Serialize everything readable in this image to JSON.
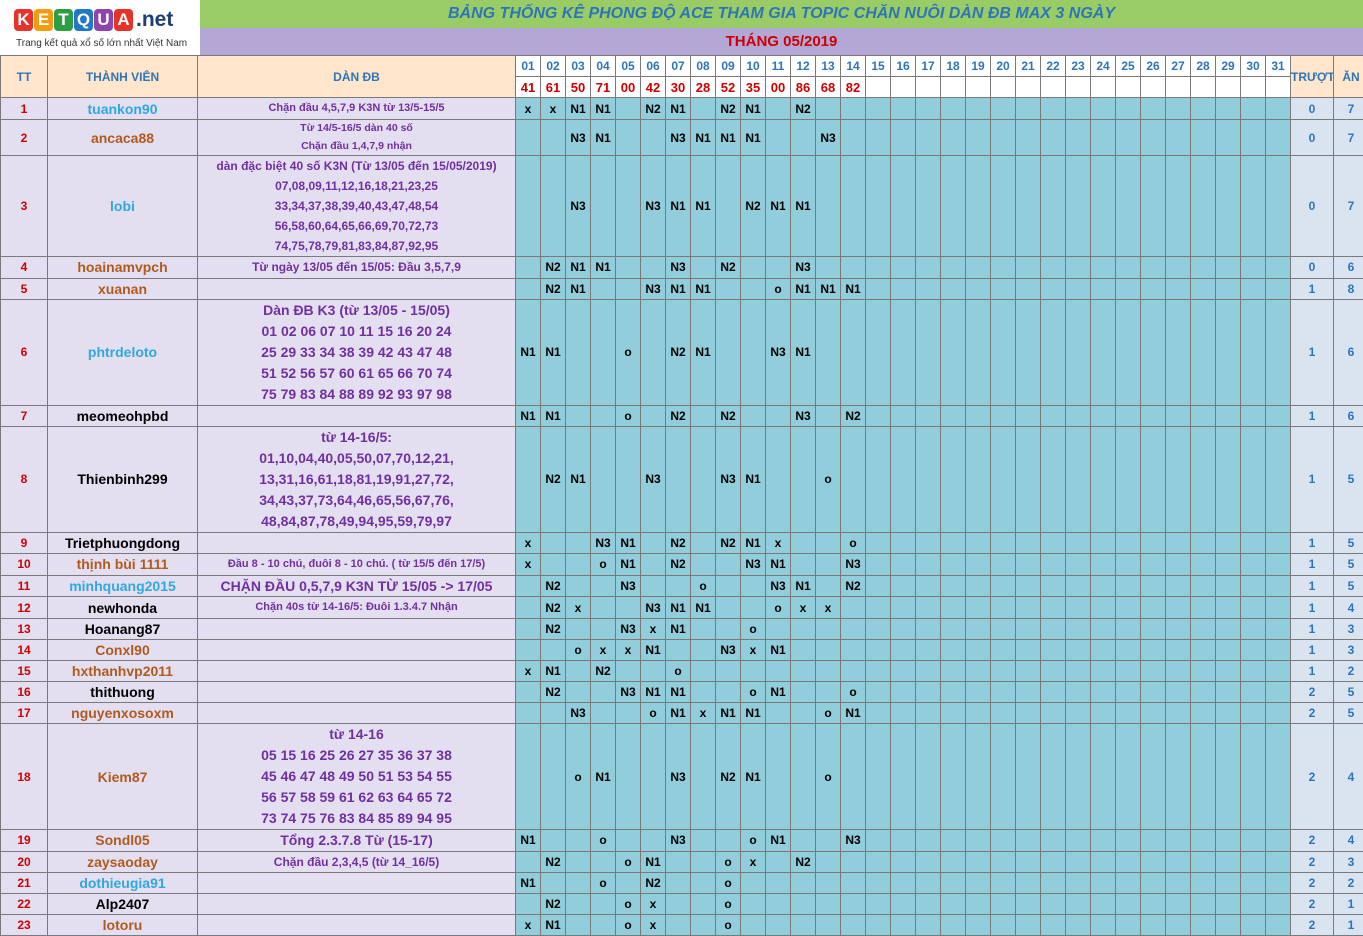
{
  "logo": {
    "letters": [
      "K",
      "E",
      "T",
      "Q",
      "U",
      "A"
    ],
    "suffix": ".net",
    "tagline": "Trang kết quả xổ số lớn nhất Việt Nam",
    "colors": [
      "#e6332a",
      "#f39c12",
      "#2e9e44",
      "#1f78c8",
      "#8e44ad",
      "#e6332a"
    ]
  },
  "title": "BẢNG THỐNG KÊ PHONG ĐỘ ACE THAM GIA TOPIC CHĂN NUÔI DÀN ĐB MAX 3 NGÀY",
  "month": "THÁNG 05/2019",
  "headers": {
    "tt": "TT",
    "member": "THÀNH VIÊN",
    "dan": "DÀN ĐB",
    "truot": "TRƯỢT",
    "an": "ĂN"
  },
  "days": [
    "01",
    "02",
    "03",
    "04",
    "05",
    "06",
    "07",
    "08",
    "09",
    "10",
    "11",
    "12",
    "13",
    "14",
    "15",
    "16",
    "17",
    "18",
    "19",
    "20",
    "21",
    "22",
    "23",
    "24",
    "25",
    "26",
    "27",
    "28",
    "29",
    "30",
    "31"
  ],
  "results": [
    "41",
    "61",
    "50",
    "71",
    "00",
    "42",
    "30",
    "28",
    "52",
    "35",
    "00",
    "86",
    "68",
    "82",
    "",
    "",
    "",
    "",
    "",
    "",
    "",
    "",
    "",
    "",
    "",
    "",
    "",
    "",
    "",
    "",
    ""
  ],
  "rows": [
    {
      "tt": "1",
      "name": "tuankon90",
      "color": "#2ea8e0",
      "dan": [
        "Chặn đầu 4,5,7,9 K3N từ 13/5-15/5"
      ],
      "fs": 11,
      "h": 21,
      "c": [
        "x",
        "x",
        "N1",
        "N1",
        "",
        "N2",
        "N1",
        "",
        "N2",
        "N1",
        "",
        "N2",
        "",
        "",
        "",
        "",
        "",
        "",
        "",
        "",
        "",
        "",
        "",
        "",
        "",
        "",
        "",
        "",
        "",
        "",
        ""
      ],
      "truot": "0",
      "an": "7"
    },
    {
      "tt": "2",
      "name": "ancaca88",
      "color": "#b05a1e",
      "dan": [
        "Từ 14/5-16/5 dàn 40 số",
        "Chặn đầu 1,4,7,9 nhận"
      ],
      "fs": 10.5,
      "h": 35,
      "c": [
        "",
        "",
        "N3",
        "N1",
        "",
        "",
        "N3",
        "N1",
        "N1",
        "N1",
        "",
        "",
        "N3",
        "",
        "",
        "",
        "",
        "",
        "",
        "",
        "",
        "",
        "",
        "",
        "",
        "",
        "",
        "",
        "",
        "",
        ""
      ],
      "truot": "0",
      "an": "7"
    },
    {
      "tt": "3",
      "name": "lobi",
      "color": "#2ea8e0",
      "dan": [
        "dàn đặc biệt 40 số K3N (Từ 13/05 đến 15/05/2019)",
        "07,08,09,11,12,16,18,21,23,25",
        "33,34,37,38,39,40,43,47,48,54",
        "56,58,60,64,65,66,69,70,72,73",
        "74,75,78,79,81,83,84,87,92,95"
      ],
      "fs": 12,
      "h": 100,
      "c": [
        "",
        "",
        "N3",
        "",
        "",
        "N3",
        "N1",
        "N1",
        "",
        "N2",
        "N1",
        "N1",
        "",
        "",
        "",
        "",
        "",
        "",
        "",
        "",
        "",
        "",
        "",
        "",
        "",
        "",
        "",
        "",
        "",
        "",
        ""
      ],
      "truot": "0",
      "an": "7"
    },
    {
      "tt": "4",
      "name": "hoainamvpch",
      "color": "#b05a1e",
      "dan": [
        "Từ ngày 13/05 đến 15/05: Đầu 3,5,7,9"
      ],
      "fs": 12,
      "h": 21,
      "c": [
        "",
        "N2",
        "N1",
        "N1",
        "",
        "",
        "N3",
        "",
        "N2",
        "",
        "",
        "N3",
        "",
        "",
        "",
        "",
        "",
        "",
        "",
        "",
        "",
        "",
        "",
        "",
        "",
        "",
        "",
        "",
        "",
        "",
        ""
      ],
      "truot": "0",
      "an": "6"
    },
    {
      "tt": "5",
      "name": "xuanan",
      "color": "#b05a1e",
      "dan": [
        ""
      ],
      "fs": 12,
      "h": 21,
      "c": [
        "",
        "N2",
        "N1",
        "",
        "",
        "N3",
        "N1",
        "N1",
        "",
        "",
        "o",
        "N1",
        "N1",
        "N1",
        "",
        "",
        "",
        "",
        "",
        "",
        "",
        "",
        "",
        "",
        "",
        "",
        "",
        "",
        "",
        "",
        ""
      ],
      "truot": "1",
      "an": "8"
    },
    {
      "tt": "6",
      "name": "phtrdeloto",
      "color": "#2ea8e0",
      "dan": [
        "Dàn ĐB K3 (từ 13/05 - 15/05)",
        "01 02 06 07 10 11 15 16 20 24",
        "25 29 33 34 38 39 42 43 47 48",
        "51 52 56 57 60 61 65 66 70 74",
        "75 79 83 84 88 89 92 93 97 98"
      ],
      "fs": 14,
      "h": 105,
      "c": [
        "N1",
        "N1",
        "",
        "",
        "o",
        "",
        "N2",
        "N1",
        "",
        "",
        "N3",
        "N1",
        "",
        "",
        "",
        "",
        "",
        "",
        "",
        "",
        "",
        "",
        "",
        "",
        "",
        "",
        "",
        "",
        "",
        "",
        ""
      ],
      "truot": "1",
      "an": "6"
    },
    {
      "tt": "7",
      "name": "meomeohpbd",
      "color": "#000000",
      "dan": [
        ""
      ],
      "fs": 12,
      "h": 21,
      "c": [
        "N1",
        "N1",
        "",
        "",
        "o",
        "",
        "N2",
        "",
        "N2",
        "",
        "",
        "N3",
        "",
        "N2",
        "",
        "",
        "",
        "",
        "",
        "",
        "",
        "",
        "",
        "",
        "",
        "",
        "",
        "",
        "",
        "",
        ""
      ],
      "truot": "1",
      "an": "6"
    },
    {
      "tt": "8",
      "name": "Thienbinh299",
      "color": "#000000",
      "dan": [
        "từ 14-16/5:",
        "01,10,04,40,05,50,07,70,12,21,",
        "13,31,16,61,18,81,19,91,27,72,",
        "34,43,37,73,64,46,65,56,67,76,",
        "48,84,87,78,49,94,95,59,79,97"
      ],
      "fs": 14,
      "h": 105,
      "c": [
        "",
        "N2",
        "N1",
        "",
        "",
        "N3",
        "",
        "",
        "N3",
        "N1",
        "",
        "",
        "o",
        "",
        "",
        "",
        "",
        "",
        "",
        "",
        "",
        "",
        "",
        "",
        "",
        "",
        "",
        "",
        "",
        "",
        ""
      ],
      "truot": "1",
      "an": "5"
    },
    {
      "tt": "9",
      "name": "Trietphuongdong",
      "color": "#000000",
      "dan": [
        ""
      ],
      "fs": 12,
      "h": 21,
      "c": [
        "x",
        "",
        "",
        "N3",
        "N1",
        "",
        "N2",
        "",
        "N2",
        "N1",
        "x",
        "",
        "",
        "o",
        "",
        "",
        "",
        "",
        "",
        "",
        "",
        "",
        "",
        "",
        "",
        "",
        "",
        "",
        "",
        "",
        ""
      ],
      "truot": "1",
      "an": "5"
    },
    {
      "tt": "10",
      "name": "thịnh bùi 1111",
      "color": "#b05a1e",
      "dan": [
        "Đầu 8 - 10 chú, đuôi 8 - 10 chú. ( từ 15/5 đến 17/5)"
      ],
      "fs": 11,
      "h": 21,
      "c": [
        "x",
        "",
        "",
        "o",
        "N1",
        "",
        "N2",
        "",
        "",
        "N3",
        "N1",
        "",
        "",
        "N3",
        "",
        "",
        "",
        "",
        "",
        "",
        "",
        "",
        "",
        "",
        "",
        "",
        "",
        "",
        "",
        "",
        ""
      ],
      "truot": "1",
      "an": "5"
    },
    {
      "tt": "11",
      "name": "minhquang2015",
      "color": "#2ea8e0",
      "dan": [
        "CHẶN ĐẦU 0,5,7,9 K3N TỪ 15/05 -> 17/05"
      ],
      "fs": 14,
      "h": 21,
      "c": [
        "",
        "N2",
        "",
        "",
        "N3",
        "",
        "",
        "o",
        "",
        "",
        "N3",
        "N1",
        "",
        "N2",
        "",
        "",
        "",
        "",
        "",
        "",
        "",
        "",
        "",
        "",
        "",
        "",
        "",
        "",
        "",
        "",
        ""
      ],
      "truot": "1",
      "an": "5"
    },
    {
      "tt": "12",
      "name": "newhonda",
      "color": "#000000",
      "dan": [
        "Chặn 40s từ 14-16/5: Đuôi 1.3.4.7 Nhận"
      ],
      "fs": 11,
      "h": 21,
      "c": [
        "",
        "N2",
        "x",
        "",
        "",
        "N3",
        "N1",
        "N1",
        "",
        "",
        "o",
        "x",
        "x",
        "",
        "",
        "",
        "",
        "",
        "",
        "",
        "",
        "",
        "",
        "",
        "",
        "",
        "",
        "",
        "",
        "",
        ""
      ],
      "truot": "1",
      "an": "4"
    },
    {
      "tt": "13",
      "name": "Hoanang87",
      "color": "#000000",
      "dan": [
        ""
      ],
      "fs": 12,
      "h": 21,
      "c": [
        "",
        "N2",
        "",
        "",
        "N3",
        "x",
        "N1",
        "",
        "",
        "o",
        "",
        "",
        "",
        "",
        "",
        "",
        "",
        "",
        "",
        "",
        "",
        "",
        "",
        "",
        "",
        "",
        "",
        "",
        "",
        "",
        ""
      ],
      "truot": "1",
      "an": "3"
    },
    {
      "tt": "14",
      "name": "Conxl90",
      "color": "#b05a1e",
      "dan": [
        ""
      ],
      "fs": 12,
      "h": 21,
      "c": [
        "",
        "",
        "o",
        "x",
        "x",
        "N1",
        "",
        "",
        "N3",
        "x",
        "N1",
        "",
        "",
        "",
        "",
        "",
        "",
        "",
        "",
        "",
        "",
        "",
        "",
        "",
        "",
        "",
        "",
        "",
        "",
        "",
        ""
      ],
      "truot": "1",
      "an": "3"
    },
    {
      "tt": "15",
      "name": "hxthanhvp2011",
      "color": "#b05a1e",
      "dan": [
        ""
      ],
      "fs": 12,
      "h": 21,
      "c": [
        "x",
        "N1",
        "",
        "N2",
        "",
        "",
        "o",
        "",
        "",
        "",
        "",
        "",
        "",
        "",
        "",
        "",
        "",
        "",
        "",
        "",
        "",
        "",
        "",
        "",
        "",
        "",
        "",
        "",
        "",
        "",
        ""
      ],
      "truot": "1",
      "an": "2"
    },
    {
      "tt": "16",
      "name": "thithuong",
      "color": "#000000",
      "dan": [
        ""
      ],
      "fs": 12,
      "h": 21,
      "c": [
        "",
        "N2",
        "",
        "",
        "N3",
        "N1",
        "N1",
        "",
        "",
        "o",
        "N1",
        "",
        "",
        "o",
        "",
        "",
        "",
        "",
        "",
        "",
        "",
        "",
        "",
        "",
        "",
        "",
        "",
        "",
        "",
        "",
        ""
      ],
      "truot": "2",
      "an": "5"
    },
    {
      "tt": "17",
      "name": "nguyenxosoxm",
      "color": "#b05a1e",
      "dan": [
        ""
      ],
      "fs": 12,
      "h": 21,
      "c": [
        "",
        "",
        "N3",
        "",
        "",
        "o",
        "N1",
        "x",
        "N1",
        "N1",
        "",
        "",
        "o",
        "N1",
        "",
        "",
        "",
        "",
        "",
        "",
        "",
        "",
        "",
        "",
        "",
        "",
        "",
        "",
        "",
        "",
        ""
      ],
      "truot": "2",
      "an": "5"
    },
    {
      "tt": "18",
      "name": "Kiem87",
      "color": "#b05a1e",
      "dan": [
        "từ 14-16",
        "05 15 16 25 26 27 35 36 37 38",
        "45 46 47 48 49 50 51 53 54 55",
        "56 57 58 59 61 62 63 64 65 72",
        "73 74 75 76 83 84 85 89 94 95"
      ],
      "fs": 14,
      "h": 105,
      "c": [
        "",
        "",
        "o",
        "N1",
        "",
        "",
        "N3",
        "",
        "N2",
        "N1",
        "",
        "",
        "o",
        "",
        "",
        "",
        "",
        "",
        "",
        "",
        "",
        "",
        "",
        "",
        "",
        "",
        "",
        "",
        "",
        "",
        ""
      ],
      "truot": "2",
      "an": "4"
    },
    {
      "tt": "19",
      "name": "Sondl05",
      "color": "#b05a1e",
      "dan": [
        "Tổng 2.3.7.8 Từ (15-17)"
      ],
      "fs": 14,
      "h": 21,
      "c": [
        "N1",
        "",
        "",
        "o",
        "",
        "",
        "N3",
        "",
        "",
        "o",
        "N1",
        "",
        "",
        "N3",
        "",
        "",
        "",
        "",
        "",
        "",
        "",
        "",
        "",
        "",
        "",
        "",
        "",
        "",
        "",
        "",
        ""
      ],
      "truot": "2",
      "an": "4"
    },
    {
      "tt": "20",
      "name": "zaysaoday",
      "color": "#b05a1e",
      "dan": [
        "Chặn đầu 2,3,4,5 (từ 14_16/5)"
      ],
      "fs": 12,
      "h": 21,
      "c": [
        "",
        "N2",
        "",
        "",
        "o",
        "N1",
        "",
        "",
        "o",
        "x",
        "",
        "N2",
        "",
        "",
        "",
        "",
        "",
        "",
        "",
        "",
        "",
        "",
        "",
        "",
        "",
        "",
        "",
        "",
        "",
        "",
        ""
      ],
      "truot": "2",
      "an": "3"
    },
    {
      "tt": "21",
      "name": "dothieugia91",
      "color": "#2ea8e0",
      "dan": [
        ""
      ],
      "fs": 12,
      "h": 21,
      "c": [
        "N1",
        "",
        "",
        "o",
        "",
        "N2",
        "",
        "",
        "o",
        "",
        "",
        "",
        "",
        "",
        "",
        "",
        "",
        "",
        "",
        "",
        "",
        "",
        "",
        "",
        "",
        "",
        "",
        "",
        "",
        "",
        ""
      ],
      "truot": "2",
      "an": "2"
    },
    {
      "tt": "22",
      "name": "Alp2407",
      "color": "#000000",
      "dan": [
        ""
      ],
      "fs": 12,
      "h": 21,
      "c": [
        "",
        "N2",
        "",
        "",
        "o",
        "x",
        "",
        "",
        "o",
        "",
        "",
        "",
        "",
        "",
        "",
        "",
        "",
        "",
        "",
        "",
        "",
        "",
        "",
        "",
        "",
        "",
        "",
        "",
        "",
        "",
        ""
      ],
      "truot": "2",
      "an": "1"
    },
    {
      "tt": "23",
      "name": "lotoru",
      "color": "#b05a1e",
      "dan": [
        ""
      ],
      "fs": 12,
      "h": 21,
      "c": [
        "x",
        "N1",
        "",
        "",
        "o",
        "x",
        "",
        "",
        "o",
        "",
        "",
        "",
        "",
        "",
        "",
        "",
        "",
        "",
        "",
        "",
        "",
        "",
        "",
        "",
        "",
        "",
        "",
        "",
        "",
        "",
        ""
      ],
      "truot": "2",
      "an": "1"
    }
  ]
}
